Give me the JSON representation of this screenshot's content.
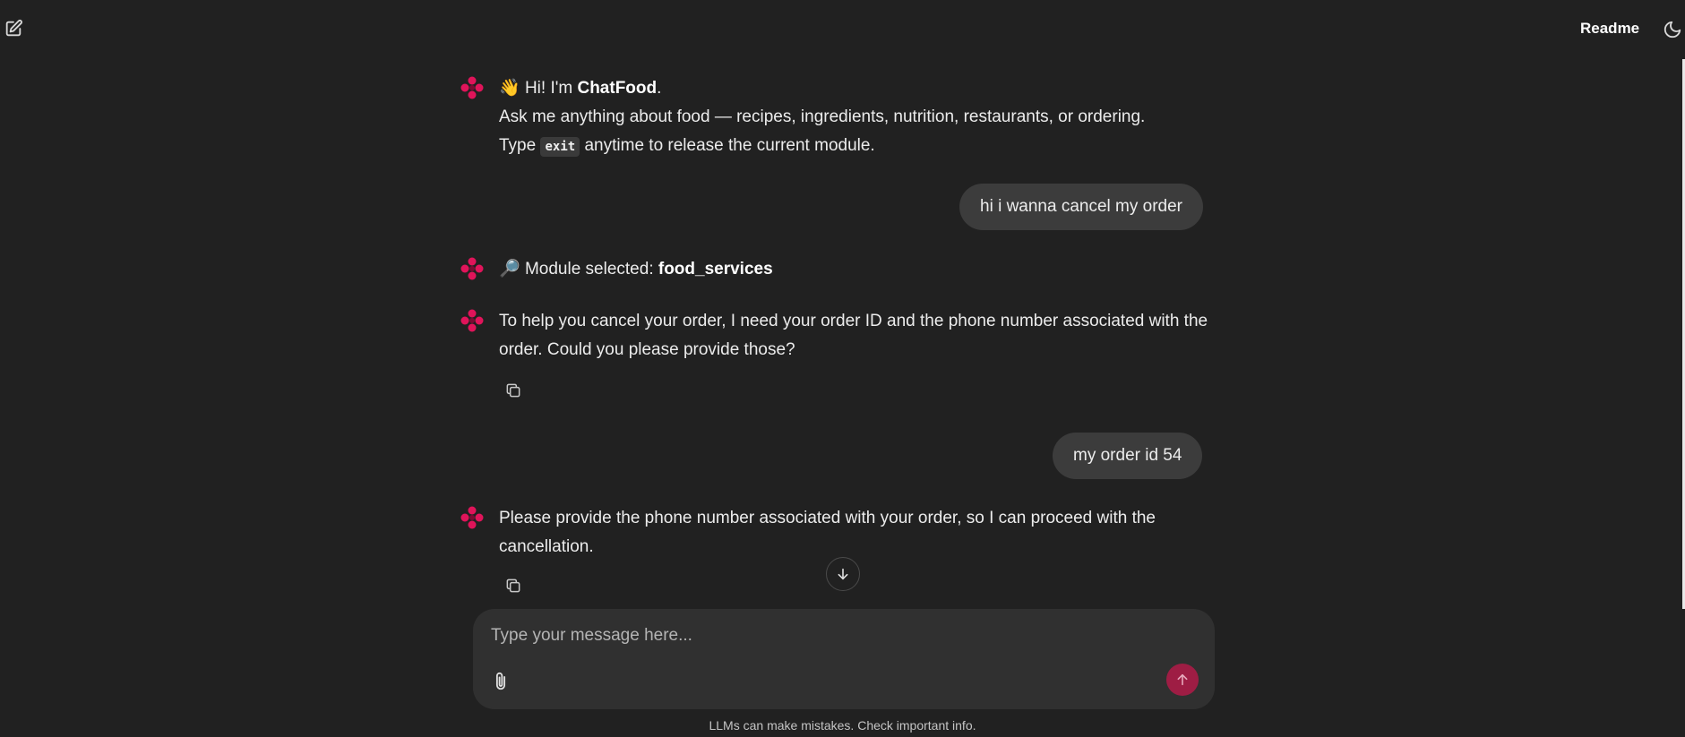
{
  "header": {
    "readme_label": "Readme",
    "new_chat_icon": "edit-icon",
    "theme_icon": "moon-icon"
  },
  "messages": [
    {
      "role": "assistant",
      "emoji": "👋",
      "greeting_prefix": "Hi! I'm ",
      "bot_name": "ChatFood",
      "greeting_suffix": ".",
      "line2": "Ask me anything about food — recipes, ingredients, nutrition, restaurants, or ordering.",
      "line3_prefix": "Type",
      "line3_code": "exit",
      "line3_suffix": "anytime to release the current module."
    },
    {
      "role": "user",
      "text": "hi i wanna cancel my order"
    },
    {
      "role": "assistant",
      "emoji": "🔎",
      "prefix": "Module selected: ",
      "module": "food_services"
    },
    {
      "role": "assistant",
      "text": "To help you cancel your order, I need your order ID and the phone number associated with the order. Could you please provide those?"
    },
    {
      "role": "user",
      "text": "my order id 54"
    },
    {
      "role": "assistant",
      "text": "Please provide the phone number associated with your order, so I can proceed with the cancellation."
    }
  ],
  "composer": {
    "placeholder": "Type your message here...",
    "attach_icon": "paperclip-icon",
    "send_icon": "arrow-up-icon"
  },
  "disclaimer": "LLMs can make mistakes. Check important info.",
  "colors": {
    "background": "#212121",
    "accent": "#e0145a",
    "send_button": "#9e1d44",
    "user_bubble": "#3c3c3c",
    "composer": "#303030"
  }
}
